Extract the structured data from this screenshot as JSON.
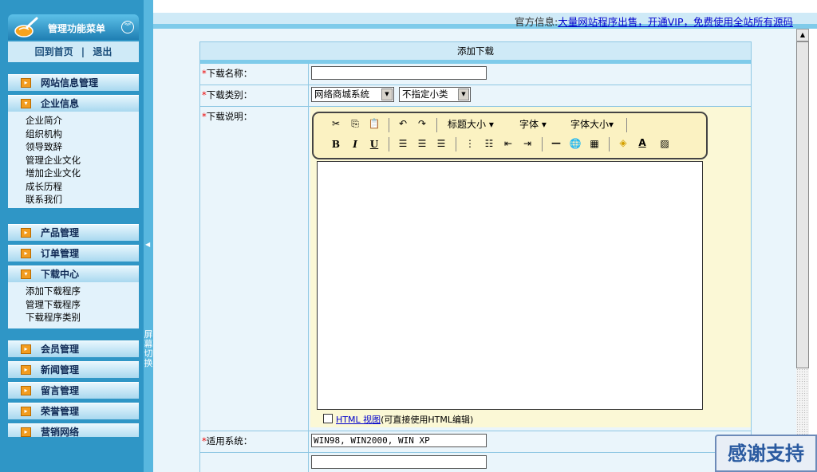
{
  "sidebar": {
    "title": "管理功能菜单",
    "home_link": "回到首页",
    "link_sep": "|",
    "logout_link": "退出",
    "groups": [
      {
        "label": "网站信息管理",
        "expanded": false,
        "items": []
      },
      {
        "label": "企业信息",
        "expanded": true,
        "items": [
          "企业简介",
          "组织机构",
          "领导致辞",
          "管理企业文化",
          "增加企业文化",
          "成长历程",
          "联系我们"
        ]
      },
      {
        "label": "产品管理",
        "expanded": false,
        "items": []
      },
      {
        "label": "订单管理",
        "expanded": false,
        "items": []
      },
      {
        "label": "下载中心",
        "expanded": true,
        "items": [
          "添加下载程序",
          "管理下载程序",
          "下载程序类别"
        ]
      },
      {
        "label": "会员管理",
        "expanded": false,
        "items": []
      },
      {
        "label": "新闻管理",
        "expanded": false,
        "items": []
      },
      {
        "label": "留言管理",
        "expanded": false,
        "items": []
      },
      {
        "label": "荣誉管理",
        "expanded": false,
        "items": []
      },
      {
        "label": "营销网络",
        "expanded": false,
        "items": []
      }
    ],
    "splitter_text": "屏幕切换"
  },
  "topbar": {
    "prefix": "官方信息:",
    "link": "大量网站程序出售，开通VIP，免费使用全站所有源码"
  },
  "form": {
    "title": "添加下载",
    "required_mark": "*",
    "name_label": "下载名称：",
    "name_value": "",
    "category_label": "下载类别：",
    "category_value": "网络商城系统",
    "subcategory_value": "不指定小类",
    "desc_label": "下载说明：",
    "system_label": "适用系统：",
    "system_value": "WIN98, WIN2000, WIN XP"
  },
  "editor": {
    "heading_size": "标题大小",
    "font": "字体",
    "font_size": "字体大小",
    "bold": "B",
    "italic": "I",
    "underline": "U",
    "html_view": "HTML 视图",
    "html_note": "(可直接使用HTML编辑)"
  },
  "badge": "感谢支持",
  "colors": {
    "sidebar": "#2f96c6",
    "panel": "#cfeaf7",
    "content_bg": "#eaf5fb",
    "toolbar_bg": "#fbf2c2",
    "required": "#ee0000",
    "link": "#0000cc"
  }
}
